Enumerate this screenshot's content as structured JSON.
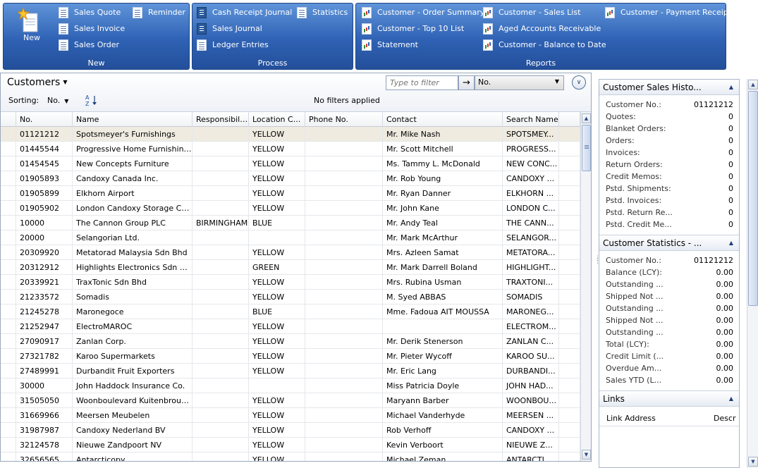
{
  "ribbon": {
    "new_group": {
      "title": "New",
      "new_label": "New",
      "items": [
        "Sales Quote",
        "Sales Invoice",
        "Sales Order",
        "Reminder"
      ]
    },
    "process_group": {
      "title": "Process",
      "items": [
        "Cash Receipt Journal",
        "Sales Journal",
        "Ledger Entries",
        "Statistics"
      ]
    },
    "reports_group": {
      "title": "Reports",
      "items": [
        "Customer - Order Summary",
        "Customer - Top 10 List",
        "Statement",
        "Customer - Sales List",
        "Aged Accounts Receivable",
        "Customer - Balance to Date",
        "Customer - Payment Receipt"
      ]
    }
  },
  "list": {
    "title": "Customers",
    "filter_placeholder": "Type to filter",
    "filter_field": "No.",
    "sorting_label": "Sorting:",
    "sorting_value": "No.",
    "filter_status": "No filters applied",
    "columns": [
      "No.",
      "Name",
      "Responsibili...",
      "Location C...",
      "Phone No.",
      "Contact",
      "Search Name"
    ],
    "rows": [
      [
        "01121212",
        "Spotsmeyer's Furnishings",
        "",
        "YELLOW",
        "",
        "Mr. Mike Nash",
        "SPOTSMEY..."
      ],
      [
        "01445544",
        "Progressive Home Furnishings",
        "",
        "YELLOW",
        "",
        "Mr. Scott Mitchell",
        "PROGRESS..."
      ],
      [
        "01454545",
        "New Concepts Furniture",
        "",
        "YELLOW",
        "",
        "Ms. Tammy L. McDonald",
        "NEW CONC..."
      ],
      [
        "01905893",
        "Candoxy Canada Inc.",
        "",
        "YELLOW",
        "",
        "Mr. Rob Young",
        "CANDOXY ..."
      ],
      [
        "01905899",
        "Elkhorn Airport",
        "",
        "YELLOW",
        "",
        "Mr. Ryan Danner",
        "ELKHORN ..."
      ],
      [
        "01905902",
        "London Candoxy Storage Ca...",
        "",
        "YELLOW",
        "",
        "Mr. John Kane",
        "LONDON C..."
      ],
      [
        "10000",
        "The Cannon Group PLC",
        "BIRMINGHAM",
        "BLUE",
        "",
        "Mr. Andy Teal",
        "THE CANN..."
      ],
      [
        "20000",
        "Selangorian Ltd.",
        "",
        "",
        "",
        "Mr. Mark McArthur",
        "SELANGOR..."
      ],
      [
        "20309920",
        "Metatorad Malaysia Sdn Bhd",
        "",
        "YELLOW",
        "",
        "Mrs. Azleen Samat",
        "METATORA..."
      ],
      [
        "20312912",
        "Highlights Electronics Sdn Bhd",
        "",
        "GREEN",
        "",
        "Mr. Mark Darrell Boland",
        "HIGHLIGHT..."
      ],
      [
        "20339921",
        "TraxTonic Sdn Bhd",
        "",
        "YELLOW",
        "",
        "Mrs. Rubina Usman",
        "TRAXTONI..."
      ],
      [
        "21233572",
        "Somadis",
        "",
        "YELLOW",
        "",
        "M. Syed ABBAS",
        "SOMADIS"
      ],
      [
        "21245278",
        "Maronegoce",
        "",
        "BLUE",
        "",
        "Mme. Fadoua AIT MOUSSA",
        "MARONEG..."
      ],
      [
        "21252947",
        "ElectroMAROC",
        "",
        "YELLOW",
        "",
        "",
        "ELECTROM..."
      ],
      [
        "27090917",
        "Zanlan Corp.",
        "",
        "YELLOW",
        "",
        "Mr. Derik Stenerson",
        "ZANLAN C..."
      ],
      [
        "27321782",
        "Karoo Supermarkets",
        "",
        "YELLOW",
        "",
        "Mr. Pieter Wycoff",
        "KAROO SU..."
      ],
      [
        "27489991",
        "Durbandit Fruit Exporters",
        "",
        "YELLOW",
        "",
        "Mr. Eric Lang",
        "DURBANDI..."
      ],
      [
        "30000",
        "John Haddock Insurance Co.",
        "",
        "",
        "",
        "Miss Patricia Doyle",
        "JOHN HAD..."
      ],
      [
        "31505050",
        "Woonboulevard Kuitenbrouwer",
        "",
        "YELLOW",
        "",
        "Maryann Barber",
        "WOONBOU..."
      ],
      [
        "31669966",
        "Meersen Meubelen",
        "",
        "YELLOW",
        "",
        "Michael Vanderhyde",
        "MEERSEN ..."
      ],
      [
        "31987987",
        "Candoxy Nederland BV",
        "",
        "YELLOW",
        "",
        "Rob Verhoff",
        "CANDOXY ..."
      ],
      [
        "32124578",
        "Nieuwe Zandpoort NV",
        "",
        "YELLOW",
        "",
        "Kevin Verboort",
        "NIEUWE Z..."
      ],
      [
        "32656565",
        "Antarcticopy",
        "",
        "YELLOW",
        "",
        "Michael Zeman",
        "ANTARCTI..."
      ]
    ]
  },
  "factboxes": {
    "sales_history": {
      "title": "Customer Sales Histo...",
      "rows": [
        [
          "Customer No.:",
          "01121212"
        ],
        [
          "Quotes:",
          "0"
        ],
        [
          "Blanket Orders:",
          "0"
        ],
        [
          "Orders:",
          "0"
        ],
        [
          "Invoices:",
          "0"
        ],
        [
          "Return Orders:",
          "0"
        ],
        [
          "Credit Memos:",
          "0"
        ],
        [
          "Pstd. Shipments:",
          "0"
        ],
        [
          "Pstd. Invoices:",
          "0"
        ],
        [
          "Pstd. Return Re...",
          "0"
        ],
        [
          "Pstd. Credit Me...",
          "0"
        ]
      ]
    },
    "statistics": {
      "title": "Customer Statistics - ...",
      "rows": [
        [
          "Customer No.:",
          "01121212"
        ],
        [
          "Balance (LCY):",
          "0.00"
        ],
        [
          "Outstanding ...",
          "0.00"
        ],
        [
          "Shipped Not ...",
          "0.00"
        ],
        [
          "Outstanding ...",
          "0.00"
        ],
        [
          "Shipped Not ...",
          "0.00"
        ],
        [
          "Outstanding ...",
          "0.00"
        ],
        [
          "Total (LCY):",
          "0.00"
        ],
        [
          "Credit Limit (...",
          "0.00"
        ],
        [
          "Overdue Am...",
          "0.00"
        ],
        [
          "Sales YTD (L...",
          "0.00"
        ]
      ]
    },
    "links": {
      "title": "Links",
      "col1": "Link Address",
      "col2": "Descri"
    }
  }
}
